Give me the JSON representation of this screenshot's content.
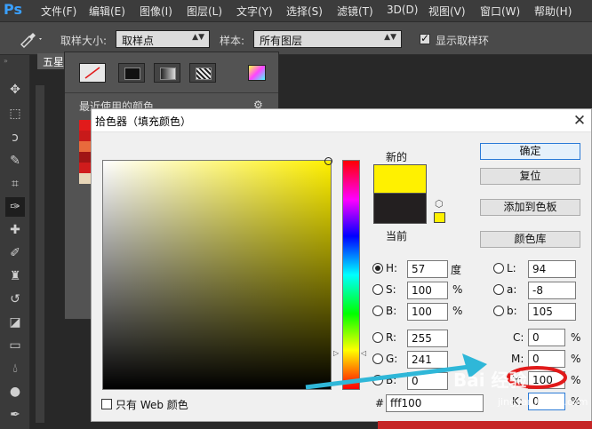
{
  "app": {
    "logo": "Ps"
  },
  "menubar": {
    "items": [
      "文件(F)",
      "编辑(E)",
      "图像(I)",
      "图层(L)",
      "文字(Y)",
      "选择(S)",
      "滤镜(T)",
      "3D(D)",
      "视图(V)",
      "窗口(W)",
      "帮助(H)"
    ]
  },
  "options_bar": {
    "sample_size_label": "取样大小:",
    "sample_size_value": "取样点",
    "sample_label": "样本:",
    "sample_value": "所有图层",
    "show_ring_label": "显示取样环",
    "show_ring_checked": true
  },
  "document": {
    "tab_label": "五星"
  },
  "swatches_panel": {
    "recent_label": "最近使用的颜色",
    "recent_colors": [
      "#e11b1b",
      "#c81a1a",
      "#e86a3c",
      "#a01515",
      "#d01c1c",
      "#e8d6b8"
    ]
  },
  "color_picker": {
    "title": "拾色器（填充颜色）",
    "new_label": "新的",
    "current_label": "当前",
    "new_color": "#fff100",
    "current_color": "#231f20",
    "buttons": {
      "ok": "确定",
      "reset": "复位",
      "add_to_swatches": "添加到色板",
      "color_libraries": "颜色库"
    },
    "hsb": {
      "h_label": "H:",
      "h_value": "57",
      "h_unit": "度",
      "s_label": "S:",
      "s_value": "100",
      "s_unit": "%",
      "b_label": "B:",
      "b_value": "100",
      "b_unit": "%"
    },
    "lab": {
      "l_label": "L:",
      "l_value": "94",
      "a_label": "a:",
      "a_value": "-8",
      "b_label": "b:",
      "b_value": "105"
    },
    "rgb": {
      "r_label": "R:",
      "r_value": "255",
      "g_label": "G:",
      "g_value": "241",
      "b_label": "B:",
      "b_value": "0"
    },
    "cmyk": {
      "c_label": "C:",
      "c_value": "0",
      "m_label": "M:",
      "m_value": "0",
      "y_label": "Y:",
      "y_value": "100",
      "k_label": "K:",
      "k_value": "0",
      "unit": "%"
    },
    "hex_label": "#",
    "hex_value": "fff100",
    "web_only_label": "只有 Web 颜色",
    "selected_radio": "H"
  },
  "watermark": {
    "text": "Bai 经验",
    "sub": "jingyan.baidu.com"
  },
  "annotation_colors": {
    "arrow": "#2fb7d8",
    "circle": "#e11a1a"
  }
}
